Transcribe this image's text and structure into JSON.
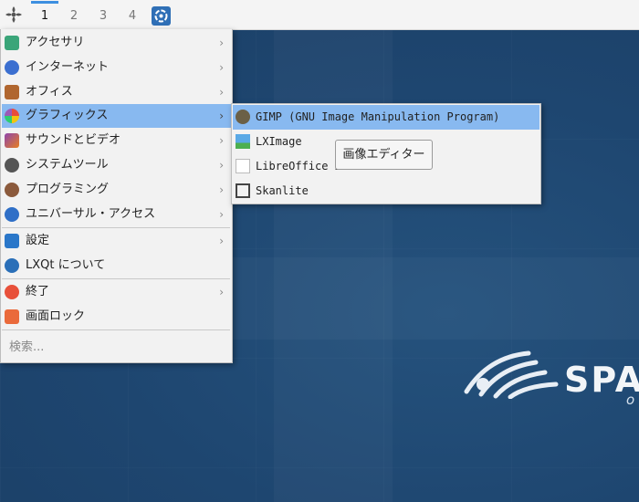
{
  "panel": {
    "workspaces": [
      "1",
      "2",
      "3",
      "4"
    ],
    "active_workspace": "1"
  },
  "menu": {
    "items": [
      {
        "label": "アクセサリ",
        "icon": "accessories-icon",
        "has_submenu": true
      },
      {
        "label": "インターネット",
        "icon": "internet-icon",
        "has_submenu": true
      },
      {
        "label": "オフィス",
        "icon": "office-icon",
        "has_submenu": true
      },
      {
        "label": "グラフィックス",
        "icon": "graphics-icon",
        "has_submenu": true
      },
      {
        "label": "サウンドとビデオ",
        "icon": "sound-video-icon",
        "has_submenu": true
      },
      {
        "label": "システムツール",
        "icon": "system-tools-icon",
        "has_submenu": true
      },
      {
        "label": "プログラミング",
        "icon": "programming-icon",
        "has_submenu": true
      },
      {
        "label": "ユニバーサル・アクセス",
        "icon": "accessibility-icon",
        "has_submenu": true
      }
    ],
    "settings": {
      "label": "設定",
      "icon": "settings-icon"
    },
    "about": {
      "label": "LXQt について",
      "icon": "lxqt-icon"
    },
    "leave": {
      "label": "終了",
      "icon": "power-icon"
    },
    "lock": {
      "label": "画面ロック",
      "icon": "lock-icon"
    },
    "search_placeholder": "検索..."
  },
  "graphics_submenu": {
    "items": [
      {
        "label": "GIMP (GNU Image Manipulation Program)",
        "icon": "gimp-icon"
      },
      {
        "label": "LXImage",
        "icon": "image-viewer-icon"
      },
      {
        "label": "LibreOffice Dr",
        "icon": "libreoffice-draw-icon"
      },
      {
        "label": "Skanlite",
        "icon": "scanner-icon"
      }
    ]
  },
  "tooltip": {
    "text": "画像エディター"
  },
  "wallpaper": {
    "brand_text": "SPA",
    "sub_text": "o"
  },
  "colors": {
    "highlight": "#88b9f0",
    "desktop": "#1f4a73",
    "panel": "#f4f4f4",
    "workspace_indicator": "#3d8fe0"
  }
}
